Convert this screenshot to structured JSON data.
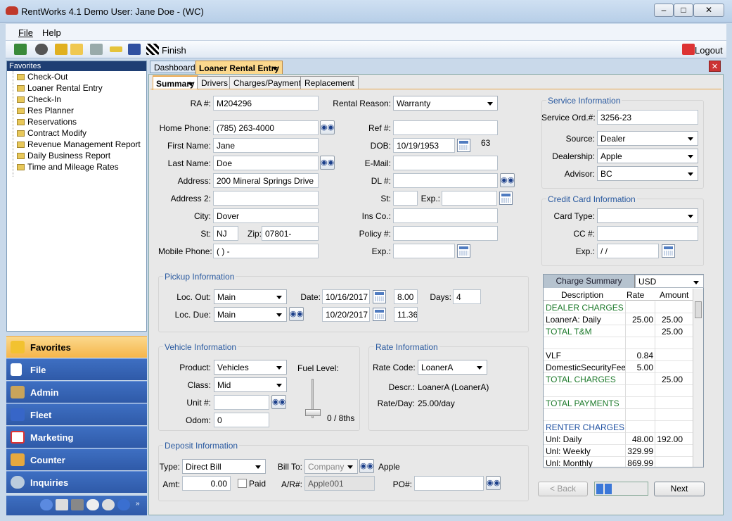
{
  "window": {
    "title": "RentWorks 4.1 Demo  User: Jane Doe - (WC)"
  },
  "menu": [
    "File",
    "Help"
  ],
  "toolbar": {
    "finish_label": "Finish",
    "logout_label": "Logout"
  },
  "sidebar": {
    "header": "Favorites",
    "items": [
      "Check-Out",
      "Loaner Rental Entry",
      "Check-In",
      "Res Planner",
      "Reservations",
      "Contract Modify",
      "Revenue Management Report",
      "Daily Business Report",
      "Time and Mileage Rates"
    ]
  },
  "nav": [
    "Favorites",
    "File",
    "Admin",
    "Fleet",
    "Marketing",
    "Counter",
    "Inquiries"
  ],
  "tabs": [
    "Dashboard",
    "Loaner Rental Entry"
  ],
  "subtabs": [
    "Summary",
    "Drivers",
    "Charges/Payments",
    "Replacement"
  ],
  "form": {
    "ra_label": "RA #:",
    "ra": "M204296",
    "home_phone_label": "Home Phone:",
    "home_phone": "(785) 263-4000",
    "first_name_label": "First Name:",
    "first_name": "Jane",
    "last_name_label": "Last Name:",
    "last_name": "Doe",
    "address_label": "Address:",
    "address": "200 Mineral Springs Drive",
    "address2_label": "Address 2:",
    "address2": "",
    "city_label": "City:",
    "city": "Dover",
    "st_label": "St:",
    "st": "NJ",
    "zip_label": "Zip:",
    "zip": "07801-",
    "mobile_label": "Mobile Phone:",
    "mobile": "(   )    -",
    "rental_reason_label": "Rental Reason:",
    "rental_reason": "Warranty",
    "ref_label": "Ref #:",
    "ref": "",
    "dob_label": "DOB:",
    "dob": "10/19/1953",
    "age": "63",
    "email_label": "E-Mail:",
    "email": "",
    "dl_label": "DL #:",
    "dl": "",
    "dl_st_label": "St:",
    "exp_label": "Exp.:",
    "ins_label": "Ins Co.:",
    "policy_label": "Policy #:",
    "policy_exp_label": "Exp.:"
  },
  "pickup": {
    "title": "Pickup Information",
    "loc_out_label": "Loc. Out:",
    "loc_out": "Main",
    "loc_due_label": "Loc. Due:",
    "loc_due": "Main",
    "date_label": "Date:",
    "date_out": "10/16/2017",
    "time_out": "8.00",
    "date_due": "10/20/2017",
    "time_due": "11.36",
    "days_label": "Days:",
    "days": "4"
  },
  "vehicle": {
    "title": "Vehicle Information",
    "product_label": "Product:",
    "product": "Vehicles",
    "class_label": "Class:",
    "class": "Mid",
    "unit_label": "Unit #:",
    "unit": "",
    "odom_label": "Odom:",
    "odom": "0",
    "fuel_label": "Fuel Level:",
    "fuel_value": "0 / 8ths"
  },
  "rate": {
    "title": "Rate Information",
    "code_label": "Rate Code:",
    "code": "LoanerA",
    "descr_label": "Descr.:",
    "descr": "LoanerA (LoanerA)",
    "perday_label": "Rate/Day:",
    "perday": "25.00/day"
  },
  "deposit": {
    "title": "Deposit Information",
    "type_label": "Type:",
    "type": "Direct Bill",
    "billto_label": "Bill To:",
    "billto": "Company",
    "billto_name": "Apple",
    "amt_label": "Amt:",
    "amt": "0.00",
    "paid_label": "Paid",
    "ar_label": "A/R#:",
    "ar": "Apple001",
    "po_label": "PO#:",
    "po": ""
  },
  "service": {
    "title": "Service Information",
    "ord_label": "Service Ord.#:",
    "ord": "3256-23",
    "source_label": "Source:",
    "source": "Dealer",
    "dealership_label": "Dealership:",
    "dealership": "Apple",
    "advisor_label": "Advisor:",
    "advisor": "BC"
  },
  "credit": {
    "title": "Credit Card Information",
    "type_label": "Card Type:",
    "type": "",
    "cc_label": "CC #:",
    "cc": "",
    "exp_label": "Exp.:",
    "exp": " / /"
  },
  "charges": {
    "tab": "Charge Summary",
    "currency": "USD",
    "headers": [
      "Description",
      "Rate",
      "Amount"
    ],
    "rows": [
      {
        "d": "DEALER CHARGES",
        "r": "",
        "a": "",
        "c": "green"
      },
      {
        "d": "LoanerA: Daily",
        "r": "25.00",
        "a": "25.00",
        "c": ""
      },
      {
        "d": "TOTAL T&M",
        "r": "",
        "a": "25.00",
        "c": "green"
      },
      {
        "d": "",
        "r": "",
        "a": "",
        "c": ""
      },
      {
        "d": "VLF",
        "r": "0.84",
        "a": "",
        "c": ""
      },
      {
        "d": "DomesticSecurityFee",
        "r": "5.00",
        "a": "",
        "c": ""
      },
      {
        "d": "TOTAL CHARGES",
        "r": "",
        "a": "25.00",
        "c": "green"
      },
      {
        "d": "",
        "r": "",
        "a": "",
        "c": ""
      },
      {
        "d": "TOTAL PAYMENTS",
        "r": "",
        "a": "",
        "c": "green"
      },
      {
        "d": "",
        "r": "",
        "a": "",
        "c": ""
      },
      {
        "d": "RENTER CHARGES",
        "r": "",
        "a": "",
        "c": "blue"
      },
      {
        "d": "Unl: Daily",
        "r": "48.00",
        "a": "192.00",
        "c": ""
      },
      {
        "d": "Unl: Weekly",
        "r": "329.99",
        "a": "",
        "c": ""
      },
      {
        "d": "Unl: Monthly",
        "r": "869.99",
        "a": "",
        "c": ""
      }
    ]
  },
  "buttons": {
    "back": "< Back",
    "next": "Next"
  }
}
